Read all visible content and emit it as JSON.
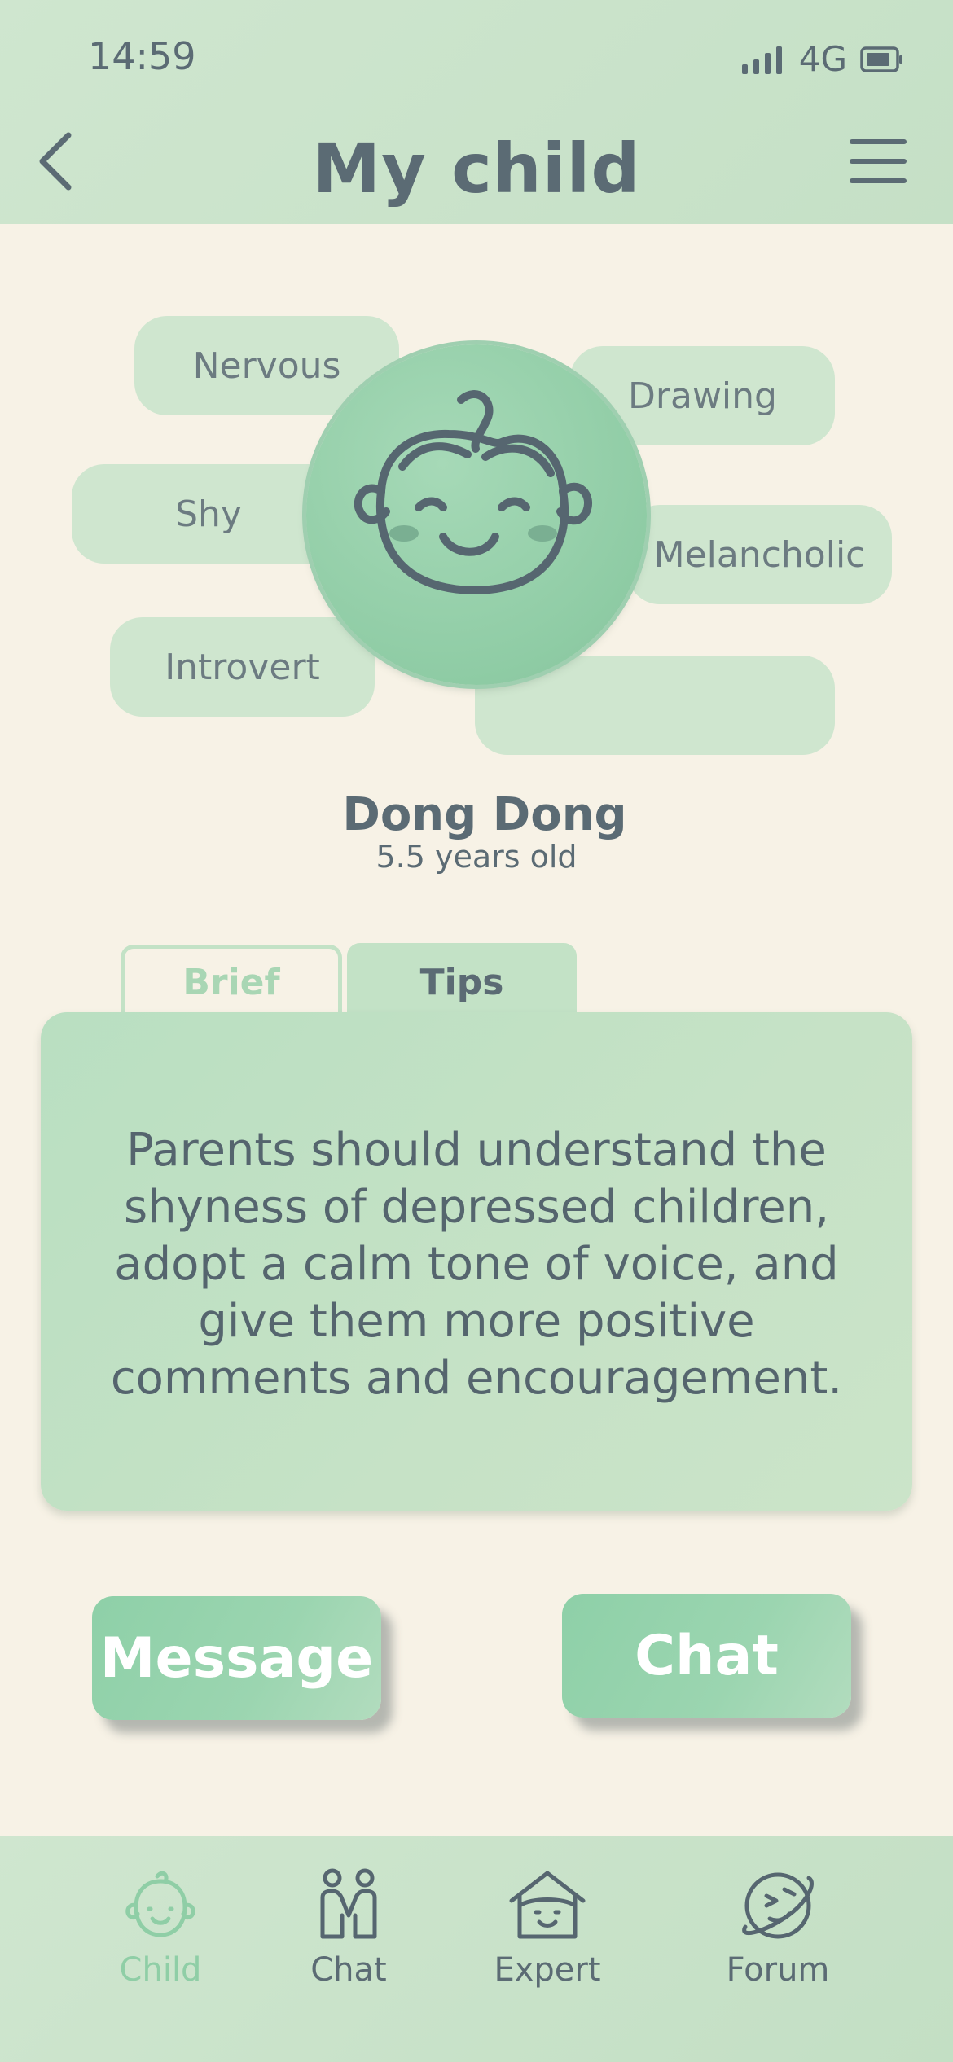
{
  "status_bar": {
    "time": "14:59",
    "network": "4G"
  },
  "header": {
    "title": "My child",
    "back_icon": "chevron-left-icon",
    "menu_icon": "hamburger-menu-icon"
  },
  "child": {
    "name": "Dong Dong",
    "age": "5.5 years old",
    "traits": [
      "Nervous",
      "Shy",
      "Introvert",
      "Drawing",
      "Melancholic",
      ""
    ],
    "avatar_icon": "child-face-icon"
  },
  "tabs": {
    "brief": "Brief",
    "tips": "Tips",
    "active": "Tips"
  },
  "tip_text": "Parents should understand the shyness of depressed children, adopt a calm tone of voice, and give them more positive comments and encouragement.",
  "actions": {
    "message": "Message",
    "chat": "Chat"
  },
  "bottom_nav": {
    "items": [
      {
        "label": "Child",
        "icon": "child-face-icon",
        "active": true
      },
      {
        "label": "Chat",
        "icon": "people-icon",
        "active": false
      },
      {
        "label": "Expert",
        "icon": "house-icon",
        "active": false
      },
      {
        "label": "Forum",
        "icon": "planet-icon",
        "active": false
      }
    ]
  },
  "colors": {
    "background": "#f7f2e6",
    "header": "#cfe6cf",
    "accent": "#8fcea6",
    "text": "#5b6b74"
  }
}
